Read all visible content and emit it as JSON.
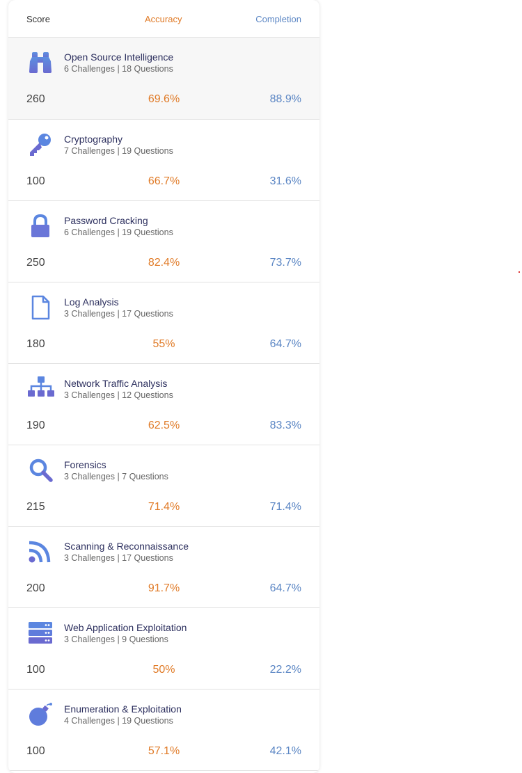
{
  "header": {
    "score": "Score",
    "accuracy": "Accuracy",
    "completion": "Completion"
  },
  "colors": {
    "accent_orange": "#e07a26",
    "accent_blue": "#5b86c4",
    "icon": "#5a7fd6"
  },
  "rows": [
    {
      "icon": "binoculars-icon",
      "title": "Open Source Intelligence",
      "sub": "6 Challenges | 18 Questions",
      "score": "260",
      "accuracy": "69.6%",
      "completion": "88.9%"
    },
    {
      "icon": "key-icon",
      "title": "Cryptography",
      "sub": "7 Challenges | 19 Questions",
      "score": "100",
      "accuracy": "66.7%",
      "completion": "31.6%"
    },
    {
      "icon": "lock-icon",
      "title": "Password Cracking",
      "sub": "6 Challenges | 19 Questions",
      "score": "250",
      "accuracy": "82.4%",
      "completion": "73.7%"
    },
    {
      "icon": "file-icon",
      "title": "Log Analysis",
      "sub": "3 Challenges | 17 Questions",
      "score": "180",
      "accuracy": "55%",
      "completion": "64.7%"
    },
    {
      "icon": "network-icon",
      "title": "Network Traffic Analysis",
      "sub": "3 Challenges | 12 Questions",
      "score": "190",
      "accuracy": "62.5%",
      "completion": "83.3%"
    },
    {
      "icon": "search-icon",
      "title": "Forensics",
      "sub": "3 Challenges | 7 Questions",
      "score": "215",
      "accuracy": "71.4%",
      "completion": "71.4%"
    },
    {
      "icon": "rss-icon",
      "title": "Scanning & Reconnaissance",
      "sub": "3 Challenges | 17 Questions",
      "score": "200",
      "accuracy": "91.7%",
      "completion": "64.7%"
    },
    {
      "icon": "server-icon",
      "title": "Web Application Exploitation",
      "sub": "3 Challenges | 9 Questions",
      "score": "100",
      "accuracy": "50%",
      "completion": "22.2%"
    },
    {
      "icon": "bomb-icon",
      "title": "Enumeration & Exploitation",
      "sub": "4 Challenges | 19 Questions",
      "score": "100",
      "accuracy": "57.1%",
      "completion": "42.1%"
    }
  ]
}
